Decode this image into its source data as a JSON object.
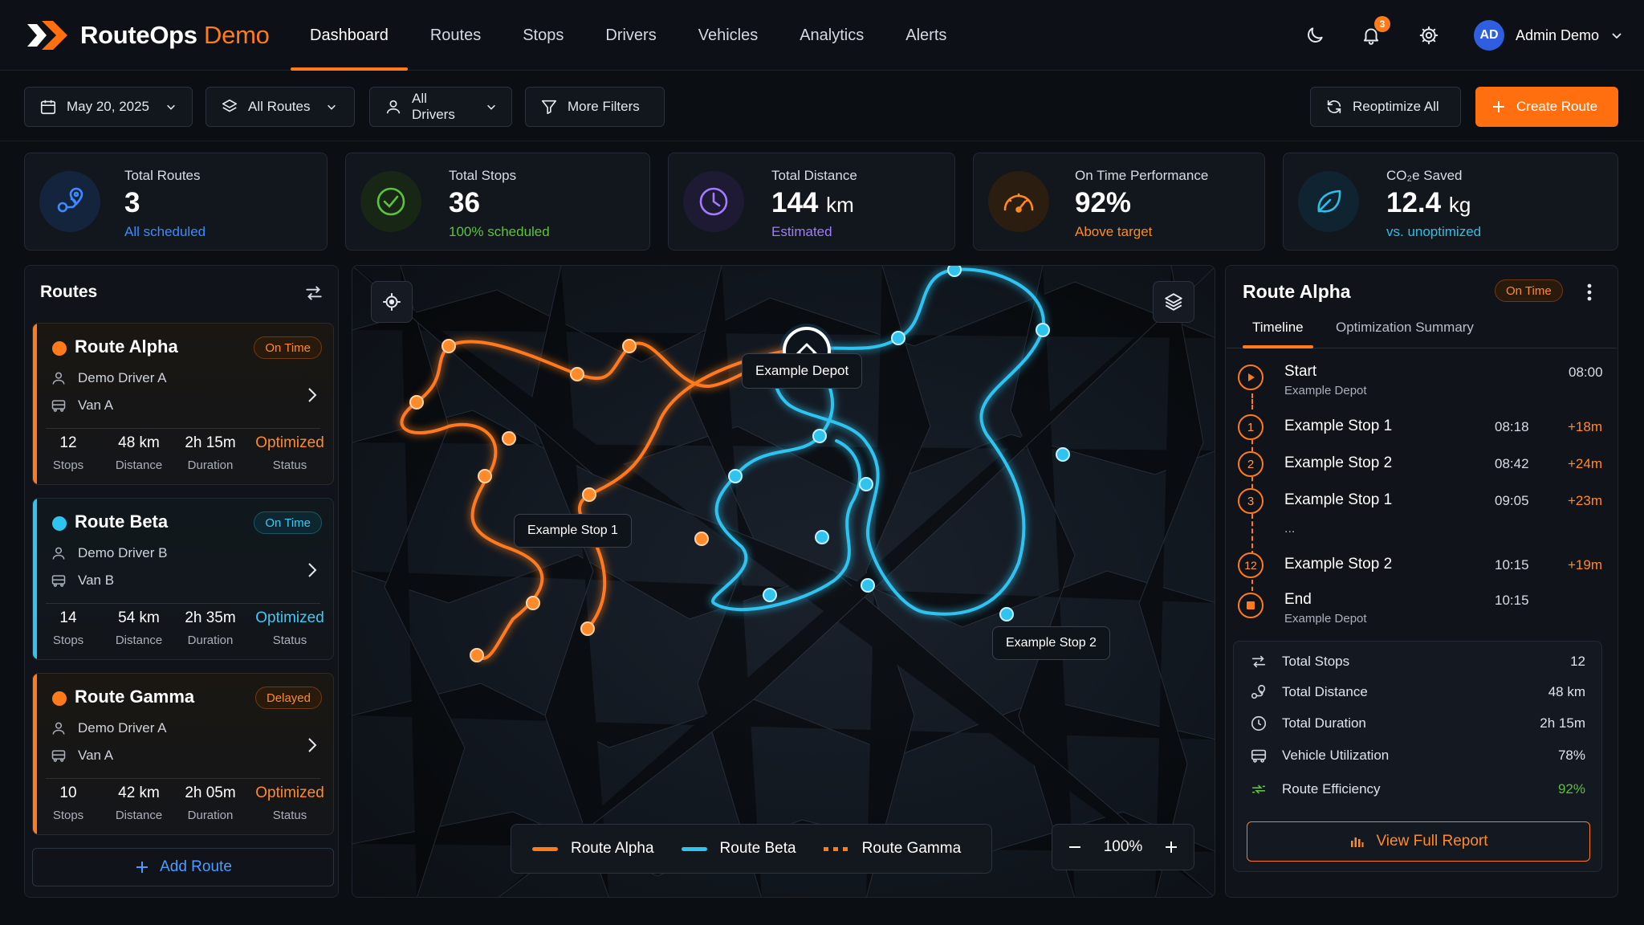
{
  "app": {
    "brand": "RouteOps",
    "brand_suffix": "Demo"
  },
  "nav": {
    "items": [
      {
        "label": "Dashboard",
        "active": true
      },
      {
        "label": "Routes"
      },
      {
        "label": "Stops"
      },
      {
        "label": "Drivers"
      },
      {
        "label": "Vehicles"
      },
      {
        "label": "Analytics"
      },
      {
        "label": "Alerts"
      }
    ],
    "notifications": "3",
    "user": {
      "initials": "AD",
      "name": "Admin Demo"
    }
  },
  "filters": {
    "date": "May 20, 2025",
    "routes": "All Routes",
    "drivers": "All Drivers",
    "more": "More Filters",
    "reoptimize": "Reoptimize All",
    "create": "Create Route"
  },
  "kpis": [
    {
      "title": "Total Routes",
      "value": "3",
      "unit": "",
      "sub": "All scheduled",
      "color": "#3d8bff",
      "icon": "route-pin-icon"
    },
    {
      "title": "Total Stops",
      "value": "36",
      "unit": "",
      "sub": "100% scheduled",
      "color": "#5cc43a",
      "icon": "check-circle-icon"
    },
    {
      "title": "Total Distance",
      "value": "144",
      "unit": "km",
      "sub": "Estimated",
      "color": "#a27bff",
      "icon": "clock-icon"
    },
    {
      "title": "On Time Performance",
      "value": "92%",
      "unit": "",
      "sub": "Above target",
      "color": "#ff8a1f",
      "icon": "gauge-icon"
    },
    {
      "title": "CO₂e Saved",
      "value": "12.4",
      "unit": "kg",
      "sub": "vs. unoptimized",
      "color": "#2dbfe8",
      "icon": "leaf-icon"
    }
  ],
  "routes_panel": {
    "title": "Routes",
    "add_label": "Add Route",
    "routes": [
      {
        "name": "Route Alpha",
        "status": "On Time",
        "driver": "Demo Driver A",
        "vehicle": "Van A",
        "stops": "12",
        "distance": "48 km",
        "duration": "2h 15m",
        "opt": "Optimized",
        "color": "#ff7a1a",
        "status_color": "#ff8a2a"
      },
      {
        "name": "Route Beta",
        "status": "On Time",
        "driver": "Demo Driver B",
        "vehicle": "Van B",
        "stops": "14",
        "distance": "54 km",
        "duration": "2h 35m",
        "opt": "Optimized",
        "color": "#2fc3f0",
        "status_color": "#3fc9f2"
      },
      {
        "name": "Route Gamma",
        "status": "Delayed",
        "driver": "Demo Driver A",
        "vehicle": "Van A",
        "stops": "10",
        "distance": "42 km",
        "duration": "2h 05m",
        "opt": "Optimized",
        "color": "#ff7a1a",
        "status_color": "#ff8a2a"
      }
    ],
    "stat_labels": {
      "stops": "Stops",
      "distance": "Distance",
      "duration": "Duration",
      "status": "Status"
    }
  },
  "map": {
    "depot_label": "Example Depot",
    "stop1_label": "Example Stop 1",
    "stop2_label": "Example Stop 2",
    "legend": [
      "Route Alpha",
      "Route Beta",
      "Route Gamma"
    ],
    "zoom": "100%"
  },
  "detail": {
    "title": "Route Alpha",
    "status": "On Time",
    "tabs": [
      "Timeline",
      "Optimization Summary"
    ],
    "timeline": [
      {
        "marker": "start",
        "name": "Start",
        "sub": "Example Depot",
        "time": "08:00",
        "delta": ""
      },
      {
        "marker": "1",
        "name": "Example Stop 1",
        "time": "08:18",
        "delta": "+18m"
      },
      {
        "marker": "2",
        "name": "Example Stop 2",
        "time": "08:42",
        "delta": "+24m"
      },
      {
        "marker": "3",
        "name": "Example Stop 1",
        "time": "09:05",
        "delta": "+23m"
      },
      {
        "marker": "12",
        "name": "Example Stop 2",
        "time": "10:15",
        "delta": "+19m"
      },
      {
        "marker": "end",
        "name": "End",
        "sub": "Example Depot",
        "time": "10:15",
        "delta": ""
      }
    ],
    "ellipsis": "...",
    "summary": [
      {
        "label": "Total Stops",
        "value": "12"
      },
      {
        "label": "Total Distance",
        "value": "48 km"
      },
      {
        "label": "Total Duration",
        "value": "2h 15m"
      },
      {
        "label": "Vehicle Utilization",
        "value": "78%"
      },
      {
        "label": "Route Efficiency",
        "value": "92%",
        "highlight": true
      }
    ],
    "report_label": "View Full Report"
  }
}
